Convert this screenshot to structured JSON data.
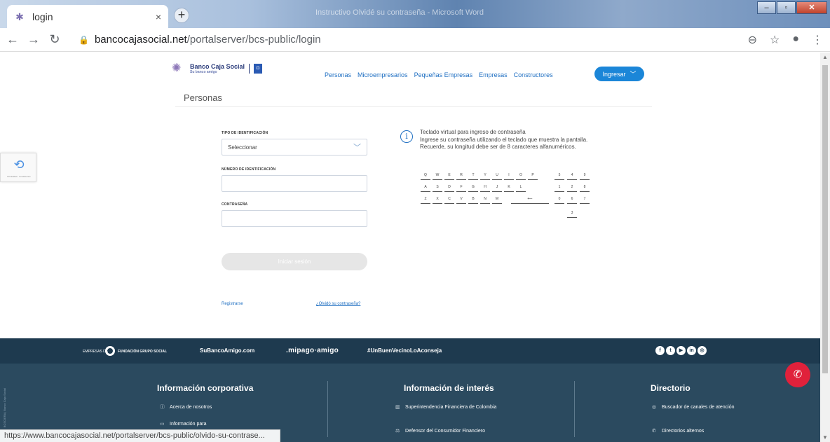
{
  "browser": {
    "tab_title": "login",
    "close_glyph": "×",
    "new_tab_glyph": "+",
    "window_title": "Instructivo Olvidé su contraseña - Microsoft Word",
    "url_host": "bancocajasocial.net",
    "url_path": "/portalserver/bcs-public/login",
    "status_url": "https://www.bancocajasocial.net/portalserver/bcs-public/olvido-su-contrase..."
  },
  "header": {
    "logo_name": "Banco Caja Social",
    "logo_tag": "Su banco amigo",
    "nav": [
      "Personas",
      "Microempresarios",
      "Pequeñas Empresas",
      "Empresas",
      "Constructores"
    ],
    "ingresar": "Ingresar"
  },
  "page": {
    "section_title": "Personas"
  },
  "form": {
    "tipo_label": "TIPO DE IDENTIFICACIÓN",
    "tipo_value": "Seleccionar",
    "numero_label": "NÚMERO DE IDENTIFICACIÓN",
    "contrasena_label": "CONTRASEÑA",
    "login_button": "Iniciar sesión",
    "register_link": "Registrarse",
    "forgot_link": "¿Olvidó su contraseña?"
  },
  "keyboard": {
    "info_icon": "i",
    "title": "Teclado virtual para ingreso de contraseña",
    "line1": "Ingrese su contraseña utilizando el teclado que muestra la pantalla.",
    "line2": "Recuerde, su longitud debe ser de 8 caracteres alfanuméricos.",
    "row1": [
      "Q",
      "W",
      "E",
      "R",
      "T",
      "Y",
      "U",
      "I",
      "O",
      "P"
    ],
    "row2": [
      "A",
      "S",
      "D",
      "F",
      "G",
      "H",
      "J",
      "K",
      "L"
    ],
    "row3": [
      "Z",
      "X",
      "C",
      "V",
      "B",
      "N",
      "M"
    ],
    "backspace": "⟵",
    "num_row1": [
      "5",
      "4",
      "9"
    ],
    "num_row2": [
      "1",
      "2",
      "8"
    ],
    "num_row3": [
      "0",
      "6",
      "7"
    ],
    "num_row4": [
      "3"
    ]
  },
  "recaptcha": {
    "text": "Privacidad · Condiciones"
  },
  "footer": {
    "empresas_label": "EMPRESAS DE",
    "fundacion": "FUNDACIÓN GRUPO SOCIAL",
    "subanco": "SuBancoAmigo.com",
    "mipago": ".mipago·amigo",
    "hashtag": "#UnBuenVecinoLoAconseja",
    "social": [
      "f",
      "t",
      "▶",
      "in",
      "◎"
    ],
    "vertical_text": "BCSCIERA | Banco Caja Social",
    "col1_title": "Información corporativa",
    "col1_items": [
      "Acerca de nosotros",
      "Información para"
    ],
    "col2_title": "Información de interés",
    "col2_items": [
      "Superintendencia Financiera de Colombia",
      "Defensor del Consumidor Financiero"
    ],
    "col3_title": "Directorio",
    "col3_items": [
      "Buscador de canales de atención",
      "Directorios alternos"
    ]
  }
}
